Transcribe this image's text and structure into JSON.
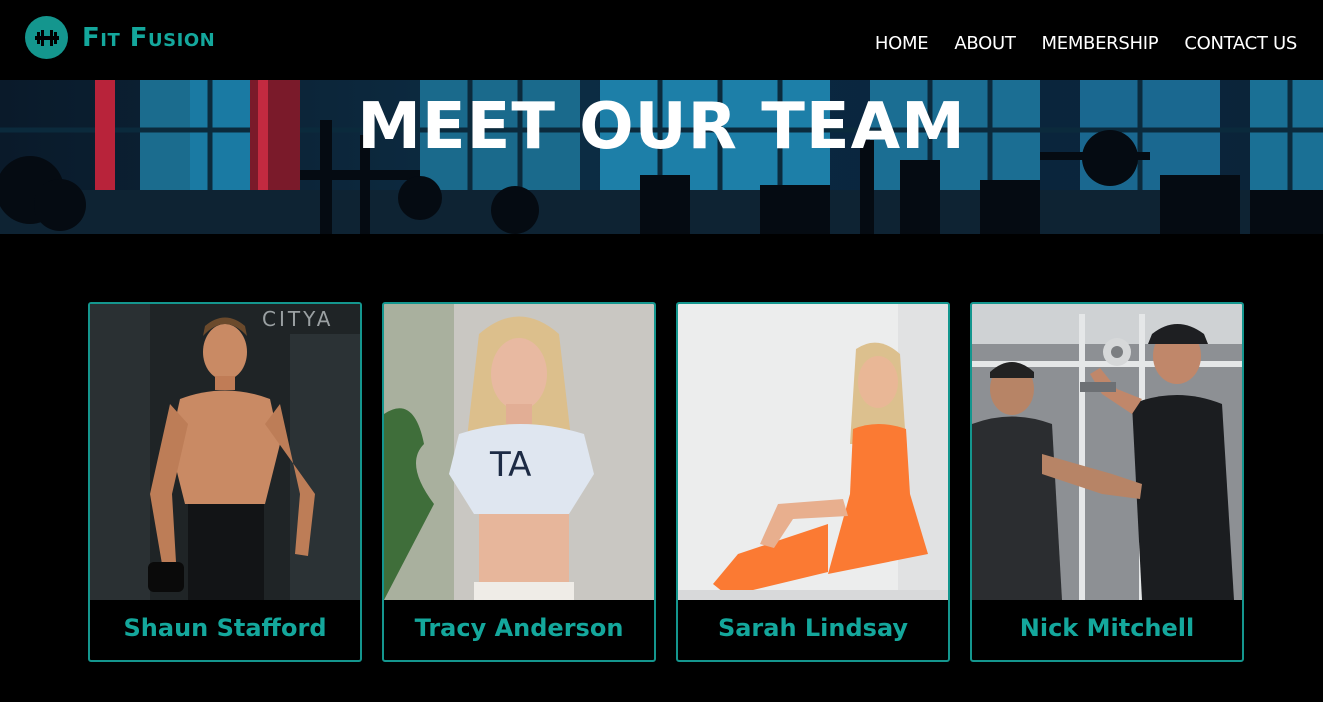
{
  "brand": {
    "name": "Fit Fusion",
    "icon": "dumbbell-icon"
  },
  "nav": {
    "items": [
      {
        "label": "HOME"
      },
      {
        "label": "ABOUT"
      },
      {
        "label": "MEMBERSHIP"
      },
      {
        "label": "CONTACT US"
      }
    ]
  },
  "hero": {
    "title": "MEET OUR TEAM"
  },
  "team": [
    {
      "name": "Shaun Stafford",
      "photo_text": "CITYA"
    },
    {
      "name": "Tracy Anderson",
      "photo_text": "TA"
    },
    {
      "name": "Sarah Lindsay"
    },
    {
      "name": "Nick Mitchell"
    }
  ],
  "colors": {
    "accent": "#14968e",
    "background": "#000000",
    "text": "#ffffff"
  }
}
